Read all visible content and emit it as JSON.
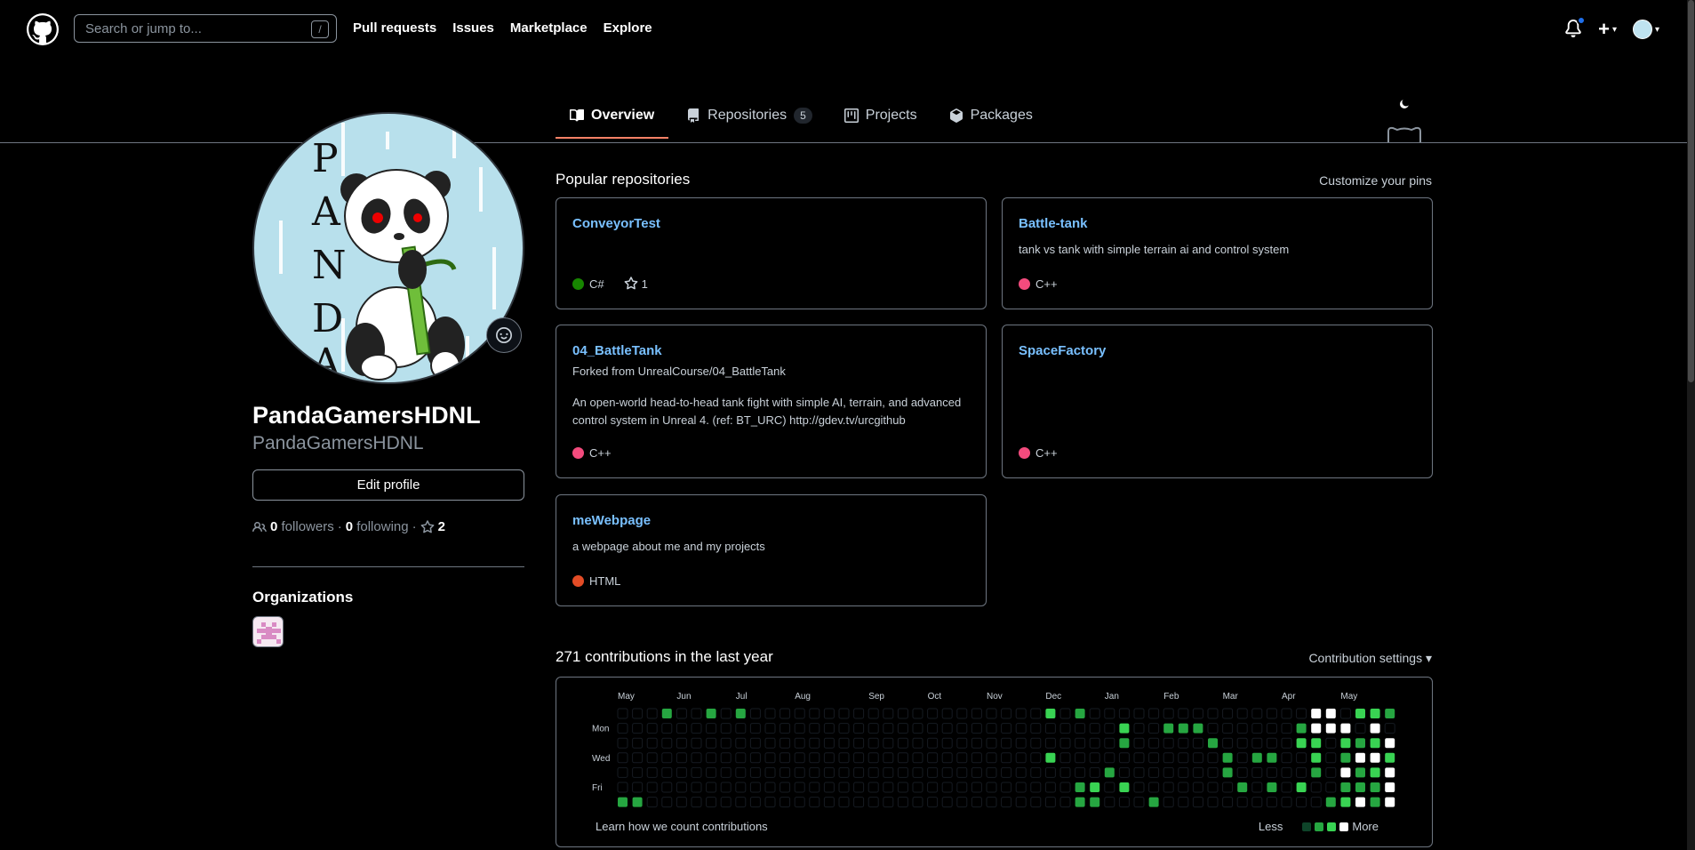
{
  "header": {
    "search_placeholder": "Search or jump to...",
    "search_shortcut": "/",
    "nav": [
      "Pull requests",
      "Issues",
      "Marketplace",
      "Explore"
    ]
  },
  "tabs": [
    {
      "label": "Overview",
      "icon": "book-icon",
      "active": true
    },
    {
      "label": "Repositories",
      "icon": "repo-icon",
      "count": "5"
    },
    {
      "label": "Projects",
      "icon": "project-icon"
    },
    {
      "label": "Packages",
      "icon": "package-icon"
    }
  ],
  "profile": {
    "name": "PandaGamersHDNL",
    "login": "PandaGamersHDNL",
    "avatar_text": [
      "P",
      "A",
      "N",
      "D",
      "A"
    ],
    "edit_label": "Edit profile",
    "followers_count": "0",
    "followers_label": "followers",
    "sep1": "·",
    "following_count": "0",
    "following_label": "following",
    "sep2": "·",
    "stars": "2",
    "organizations_title": "Organizations"
  },
  "pinned": {
    "title": "Popular repositories",
    "customize": "Customize your pins",
    "cards": [
      {
        "name": "ConveyorTest",
        "fork": "",
        "desc": "",
        "lang": "C#",
        "lang_color": "#178600",
        "stars": "1"
      },
      {
        "name": "Battle-tank",
        "fork": "",
        "desc": "tank vs tank with simple terrain ai and control system",
        "lang": "C++",
        "lang_color": "#f34b7d",
        "stars": ""
      },
      {
        "name": "04_BattleTank",
        "fork": "Forked from UnrealCourse/04_BattleTank",
        "desc": "An open-world head-to-head tank fight with simple AI, terrain, and advanced control system in Unreal 4. (ref: BT_URC) http://gdev.tv/urcgithub",
        "lang": "C++",
        "lang_color": "#f34b7d",
        "stars": ""
      },
      {
        "name": "SpaceFactory",
        "fork": "",
        "desc": "",
        "lang": "C++",
        "lang_color": "#f34b7d",
        "stars": ""
      },
      {
        "name": "meWebpage",
        "fork": "",
        "desc": "a webpage about me and my projects",
        "lang": "HTML",
        "lang_color": "#e34c26",
        "stars": ""
      }
    ]
  },
  "contributions": {
    "title": "271 contributions in the last year",
    "settings": "Contribution settings",
    "months": [
      "May",
      "Jun",
      "Jul",
      "Aug",
      "Sep",
      "Oct",
      "Nov",
      "Dec",
      "Jan",
      "Feb",
      "Mar",
      "Apr",
      "May"
    ],
    "days": [
      "Mon",
      "Wed",
      "Fri"
    ],
    "learn": "Learn how we count contributions",
    "less": "Less",
    "more": "More",
    "level_colors": [
      "#161b22",
      "#0e4429",
      "#26a641",
      "#39d353",
      "#ffffff"
    ]
  }
}
